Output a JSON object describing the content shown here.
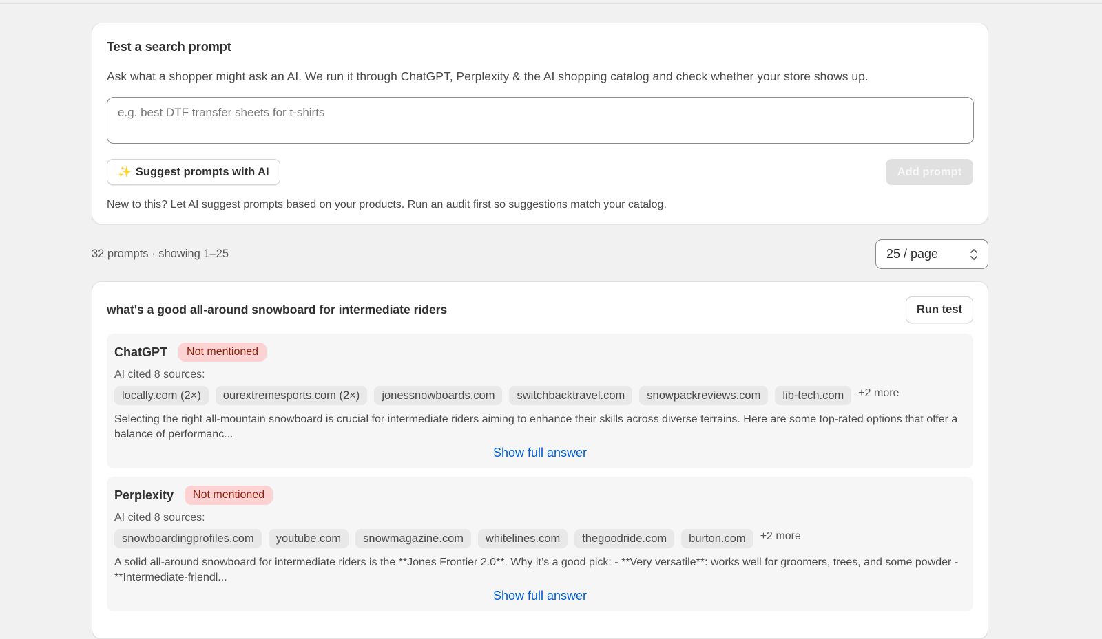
{
  "prompt_card": {
    "title": "Test a search prompt",
    "description": "Ask what a shopper might ask an AI. We run it through ChatGPT, Perplexity & the AI shopping catalog and check whether your store shows up.",
    "input_placeholder": "e.g. best DTF transfer sheets for t-shirts",
    "input_value": "",
    "suggest_icon": "sparkle-icon",
    "suggest_label": "Suggest prompts with AI",
    "add_label": "Add prompt",
    "hint": "New to this? Let AI suggest prompts based on your products. Run an audit first so suggestions match your catalog."
  },
  "list_meta": {
    "count_text": "32 prompts · showing 1–25",
    "per_page": "25 / page"
  },
  "prompt": {
    "text": "what's a good all-around snowboard for intermediate riders",
    "run_label": "Run test",
    "engines": [
      {
        "name": "ChatGPT",
        "status": "Not mentioned",
        "sources_label": "AI cited 8 sources:",
        "chips": [
          "locally.com (2×)",
          "ourextremesports.com (2×)",
          "jonessnowboards.com",
          "switchbacktravel.com",
          "snowpackreviews.com",
          "lib-tech.com"
        ],
        "more": "+2 more",
        "answer": "Selecting the right all-mountain snowboard is crucial for intermediate riders aiming to enhance their skills across diverse terrains. Here are some top-rated options that offer a balance of performanc...",
        "show_full": "Show full answer"
      },
      {
        "name": "Perplexity",
        "status": "Not mentioned",
        "sources_label": "AI cited 8 sources:",
        "chips": [
          "snowboardingprofiles.com",
          "youtube.com",
          "snowmagazine.com",
          "whitelines.com",
          "thegoodride.com",
          "burton.com"
        ],
        "more": "+2 more",
        "answer": "A solid all-around snowboard for intermediate riders is the **Jones Frontier 2.0**. Why it’s a good pick: - **Very versatile**: works well for groomers, trees, and some powder - **Intermediate-friendl...",
        "show_full": "Show full answer"
      }
    ]
  },
  "colors": {
    "badge_bg": "#fcd2d2",
    "badge_text": "#8e1f0b",
    "link": "#005bd3",
    "page_bg": "#f1f1f1"
  }
}
